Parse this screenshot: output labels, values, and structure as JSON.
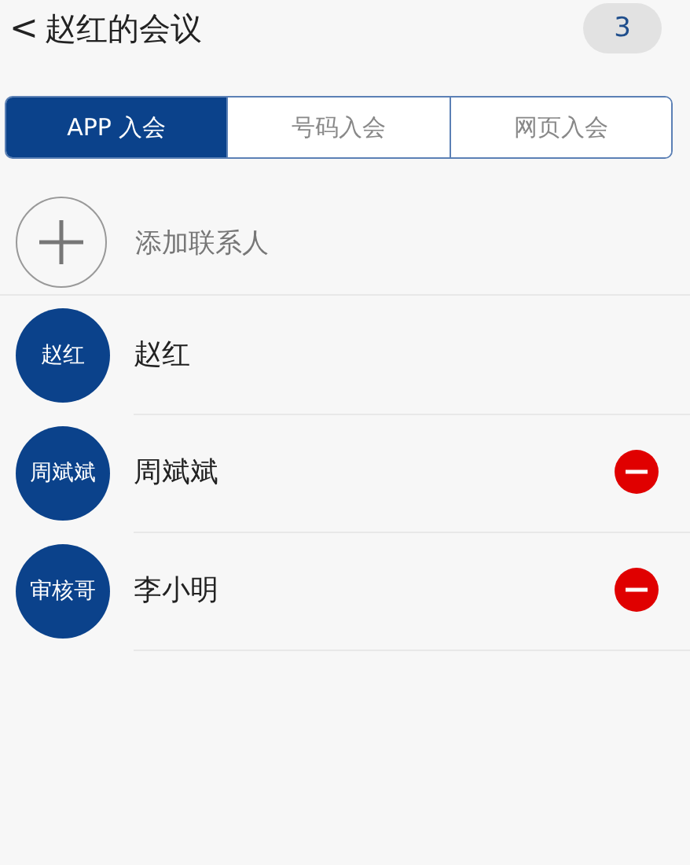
{
  "header": {
    "back_icon": "<",
    "title": "赵红的会议",
    "count": "3"
  },
  "tabs": [
    {
      "label": "APP 入会",
      "selected": true
    },
    {
      "label": "号码入会",
      "selected": false
    },
    {
      "label": "网页入会",
      "selected": false
    }
  ],
  "add_contact": {
    "label": "添加联系人"
  },
  "members": [
    {
      "avatar_text": "赵红",
      "name": "赵红",
      "removable": false
    },
    {
      "avatar_text": "周斌斌",
      "name": "周斌斌",
      "removable": true
    },
    {
      "avatar_text": "审核哥",
      "name": "李小明",
      "removable": true
    }
  ]
}
